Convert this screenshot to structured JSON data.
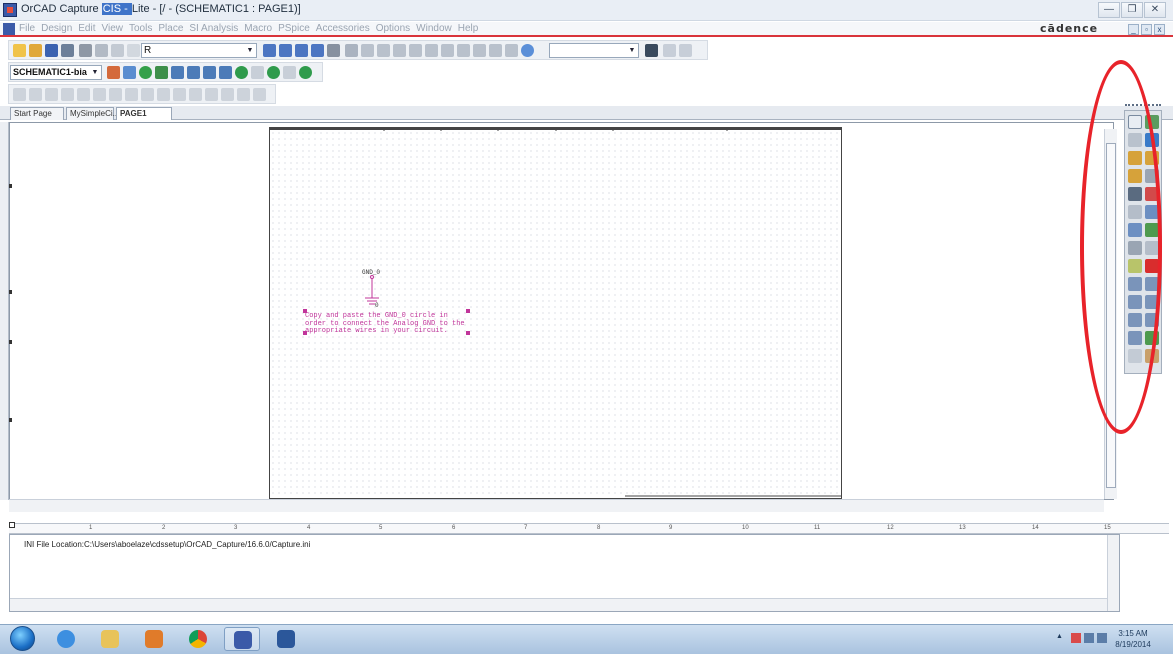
{
  "window": {
    "title_prefix": "OrCAD Capture ",
    "title_highlight": "CIS - ",
    "title_suffix": "Lite - [/ - (SCHEMATIC1 : PAGE1)]",
    "brand": "cādence",
    "minimize": "—",
    "restore": "❐",
    "close": "✕"
  },
  "menu": {
    "items": [
      "File",
      "Design",
      "Edit",
      "View",
      "Tools",
      "Place",
      "SI Analysis",
      "Macro",
      "PSpice",
      "Accessories",
      "Options",
      "Window",
      "Help"
    ],
    "mdi_minimize": "_",
    "mdi_restore": "▫",
    "mdi_close": "x"
  },
  "toolbar": {
    "search_value": "R",
    "find_value": "",
    "schematic_combo": "SCHEMATIC1-bia"
  },
  "tabs": [
    {
      "label": "Start Page"
    },
    {
      "label": "MySimpleCi..."
    },
    {
      "label": "PAGE1"
    }
  ],
  "schematic": {
    "gnd_label": "GND_0",
    "gnd_net": "0",
    "note_lines": "Copy and paste the GND_0 circle in\norder to connect the Analog GND to the\nappropriate wires in your circuit."
  },
  "ruler": {
    "marks": [
      "1",
      "2",
      "3",
      "4",
      "5",
      "6",
      "7",
      "8",
      "9",
      "10",
      "11",
      "12",
      "13",
      "14",
      "15"
    ]
  },
  "output": {
    "line": "INI File Location:C:\\Users\\aboelaze\\cdssetup\\OrCAD_Capture/16.6.0/Capture.ini"
  },
  "taskbar": {
    "time": "3:15 AM",
    "date": "8/19/2014"
  },
  "colors": {
    "annotation": "#e8232a",
    "note_text": "#c1359a",
    "menu_underline": "#d9343b"
  }
}
